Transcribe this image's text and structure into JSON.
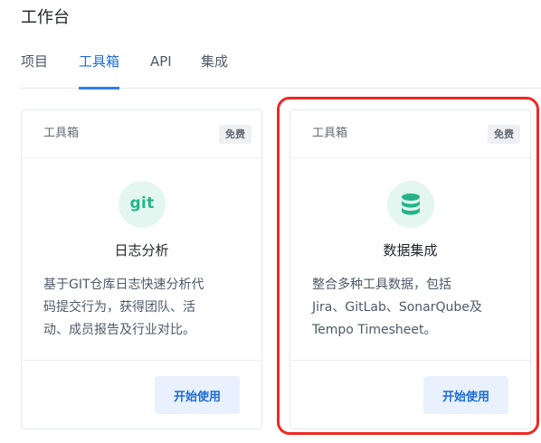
{
  "page": {
    "title": "工作台"
  },
  "tabs": [
    {
      "label": "项目",
      "active": false
    },
    {
      "label": "工具箱",
      "active": true
    },
    {
      "label": "API",
      "active": false
    },
    {
      "label": "集成",
      "active": false
    }
  ],
  "cards": [
    {
      "category": "工具箱",
      "badge": "免费",
      "icon": "git-icon",
      "icon_text": "git",
      "name": "日志分析",
      "description": [
        "基于GIT仓库日志快速分析代",
        "码提交行为，获得团队、活",
        "动、成员报告及行业对比。"
      ],
      "button_label": "开始使用"
    },
    {
      "category": "工具箱",
      "badge": "免费",
      "icon": "database-icon",
      "name": "数据集成",
      "description": [
        "整合多种工具数据，包括",
        "Jira、GitLab、SonarQube及",
        "Tempo Timesheet。"
      ],
      "button_label": "开始使用"
    }
  ],
  "colors": {
    "accent": "#2f7ff0",
    "icon_green": "#23b587",
    "highlight_red": "#ec2a23"
  }
}
